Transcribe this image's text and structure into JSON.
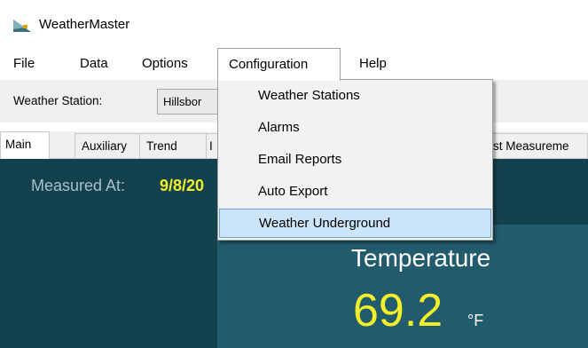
{
  "window": {
    "title": "WeatherMaster",
    "icon": "app-icon"
  },
  "menubar": {
    "items": [
      {
        "label": "File"
      },
      {
        "label": "Data"
      },
      {
        "label": "Options"
      },
      {
        "label": "Configuration"
      },
      {
        "label": "Help"
      }
    ],
    "active": "Configuration"
  },
  "toolbar": {
    "station_label": "Weather Station:",
    "station_value": "Hillsbor"
  },
  "tabs": [
    {
      "label": "Main"
    },
    {
      "label": "Auxiliary"
    },
    {
      "label": "Trend"
    },
    {
      "label": "I"
    },
    {
      "label": "st Measureme"
    }
  ],
  "dropdown": {
    "items": [
      {
        "label": "Weather Stations"
      },
      {
        "label": "Alarms"
      },
      {
        "label": "Email Reports"
      },
      {
        "label": "Auto Export"
      },
      {
        "label": "Weather Underground"
      }
    ],
    "highlighted": "Weather Underground"
  },
  "main": {
    "measured_label": "Measured At:",
    "measured_value": "9/8/20",
    "measured_suffix": ")",
    "temperature_label": "Temperature",
    "temperature_value": "69.2",
    "temperature_unit": "°F"
  },
  "colors": {
    "panel_bg": "#14414e",
    "value_yellow": "#f2ef2a",
    "menu_highlight": "#cce4f7"
  }
}
